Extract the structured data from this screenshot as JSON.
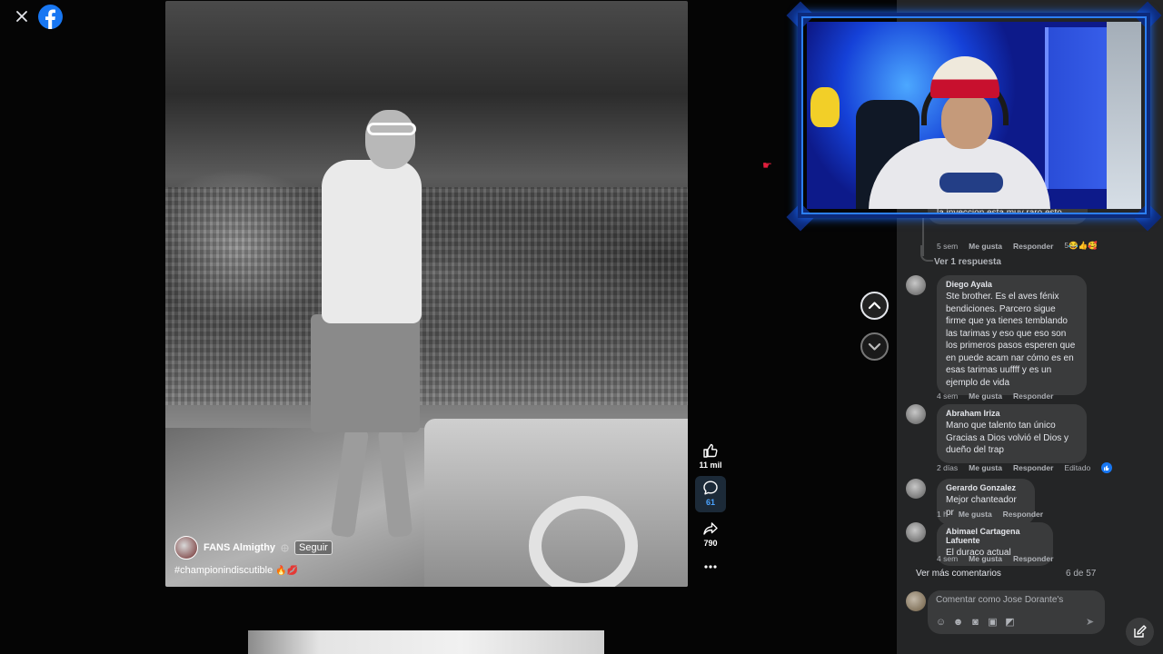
{
  "header": {
    "close_label": "Close",
    "brand": "facebook"
  },
  "post": {
    "author": "FANS Almigthy",
    "follow_label": "Seguir",
    "caption": "#championindiscutible",
    "caption_emojis": "🔥💋"
  },
  "actions": {
    "likes": "11 mil",
    "comments": "61",
    "shares": "790"
  },
  "comments_panel": {
    "partial_comment": {
      "text": "la inyeccion esta muy raro esto.",
      "time": "5 sem",
      "like_label": "Me gusta",
      "reply_label": "Responder",
      "reaction_count": "5",
      "reaction_emojis": "😂👍🥰"
    },
    "view_replies": "Ver 1 respuesta",
    "comments": [
      {
        "author": "Diego Ayala",
        "text": "Ste brother. Es el aves fénix bendiciones. Parcero sigue firme que ya tienes temblando las tarimas y eso que eso son los primeros pasos esperen que en puede acam nar cómo es en esas tarimas uuffff y es un ejemplo de vida",
        "time": "4 sem",
        "like_label": "Me gusta",
        "reply_label": "Responder",
        "edited": ""
      },
      {
        "author": "Abraham Iriza",
        "text": "Mano que talento tan único Gracias a Dios volvió el Dios y dueño del trap",
        "time": "2 días",
        "like_label": "Me gusta",
        "reply_label": "Responder",
        "edited": "Editado"
      },
      {
        "author": "Gerardo Gonzalez",
        "text": "Mejor chanteador pr",
        "time": "1 h",
        "like_label": "Me gusta",
        "reply_label": "Responder",
        "edited": ""
      },
      {
        "author": "Abimael Cartagena Lafuente",
        "text": "El duraco actual",
        "time": "4 sem",
        "like_label": "Me gusta",
        "reply_label": "Responder",
        "edited": ""
      }
    ],
    "more_comments": "Ver más comentarios",
    "counter": "6 de 57",
    "input_placeholder": "Comentar como Jose Dorante's"
  },
  "colors": {
    "brand_blue": "#1877f2",
    "panel_bg": "#242526",
    "bubble_bg": "#3a3b3c",
    "active_blue": "#4aa3ff",
    "webcam_border": "#2c7ff5"
  },
  "icons": {
    "close": "close-icon",
    "logo": "facebook-logo",
    "like": "thumbs-up-icon",
    "comment": "comment-bubble-icon",
    "share": "share-arrow-icon",
    "more": "more-dots-icon",
    "prev": "chevron-up-icon",
    "next": "chevron-down-icon",
    "compose": "compose-icon"
  }
}
